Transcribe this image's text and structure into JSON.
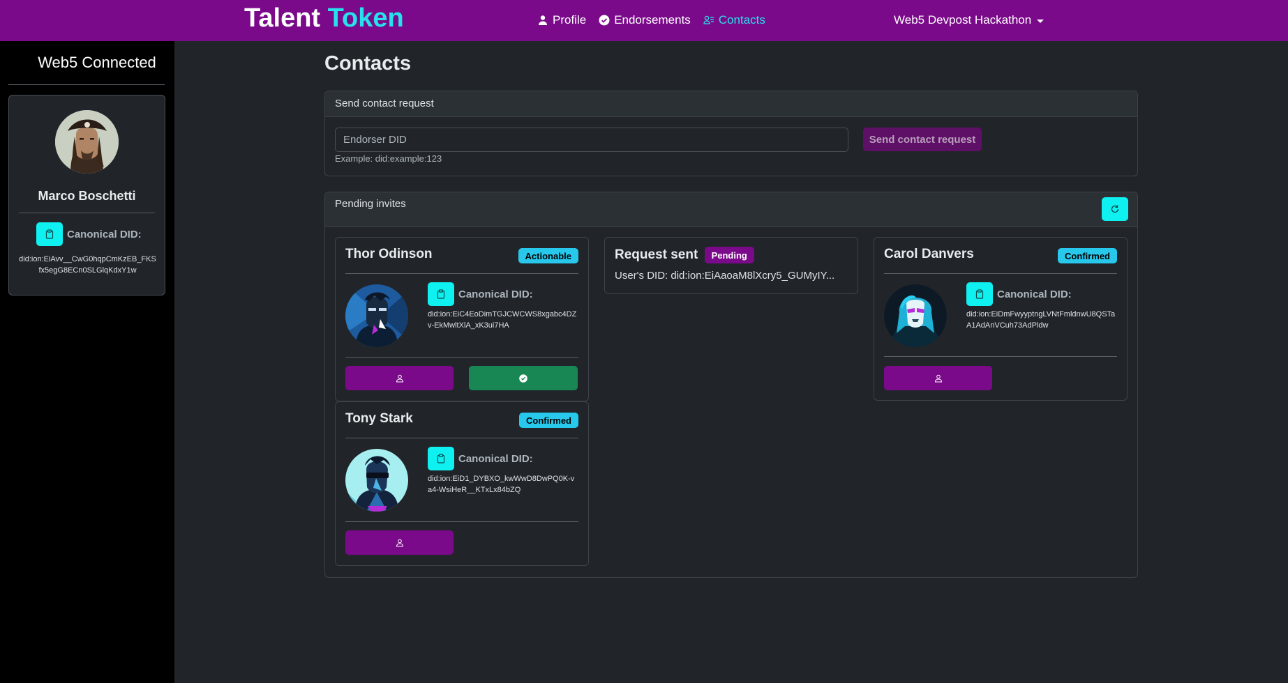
{
  "nav": {
    "brand_part1": "Talent",
    "brand_part2": "Token",
    "links": [
      {
        "label": "Profile",
        "icon": "person-icon"
      },
      {
        "label": "Endorsements",
        "icon": "check-badge-icon"
      },
      {
        "label": "Contacts",
        "icon": "contacts-icon",
        "active": true
      }
    ],
    "workspace": "Web5 Devpost Hackathon"
  },
  "sidebar": {
    "title": "Web5 Connected",
    "user_name": "Marco Boschetti",
    "did_label": "Canonical DID:",
    "did": "did:ion:EiAvv__CwG0hqpCmKzEB_FKSfx5egG8ECn0SLGlqKdxY1w"
  },
  "page_title": "Contacts",
  "send_request": {
    "header": "Send contact request",
    "placeholder": "Endorser DID",
    "help": "Example: did:example:123",
    "button": "Send contact request"
  },
  "pending": {
    "header": "Pending invites",
    "contacts": [
      {
        "name": "Thor Odinson",
        "badge": "Actionable",
        "did_label": "Canonical DID:",
        "did": "did:ion:EiC4EoDimTGJCWCWS8xgabc4DZv-EkMwltXlA_xK3ui7HA"
      },
      {
        "name": "Tony Stark",
        "badge": "Confirmed",
        "did_label": "Canonical DID:",
        "did": "did:ion:EiD1_DYBXO_kwWwD8DwPQ0K-va4-WsiHeR__KTxLx84bZQ"
      },
      {
        "name": "Carol Danvers",
        "badge": "Confirmed",
        "did_label": "Canonical DID:",
        "did": "did:ion:EiDmFwyyptngLVNtFmldnwU8QSTaA1AdAnVCuh73AdPldw"
      }
    ],
    "request_sent": {
      "title": "Request sent",
      "badge": "Pending",
      "did_line": "User's DID: did:ion:EiAaoaM8lXcry5_GUMyIY..."
    }
  },
  "colors": {
    "navbar": "#7a0a8a",
    "accent_cyan": "#27e2ec",
    "badge_blue": "#27c8ec",
    "clip_cyan": "#0ff0f0",
    "success": "#198754"
  }
}
